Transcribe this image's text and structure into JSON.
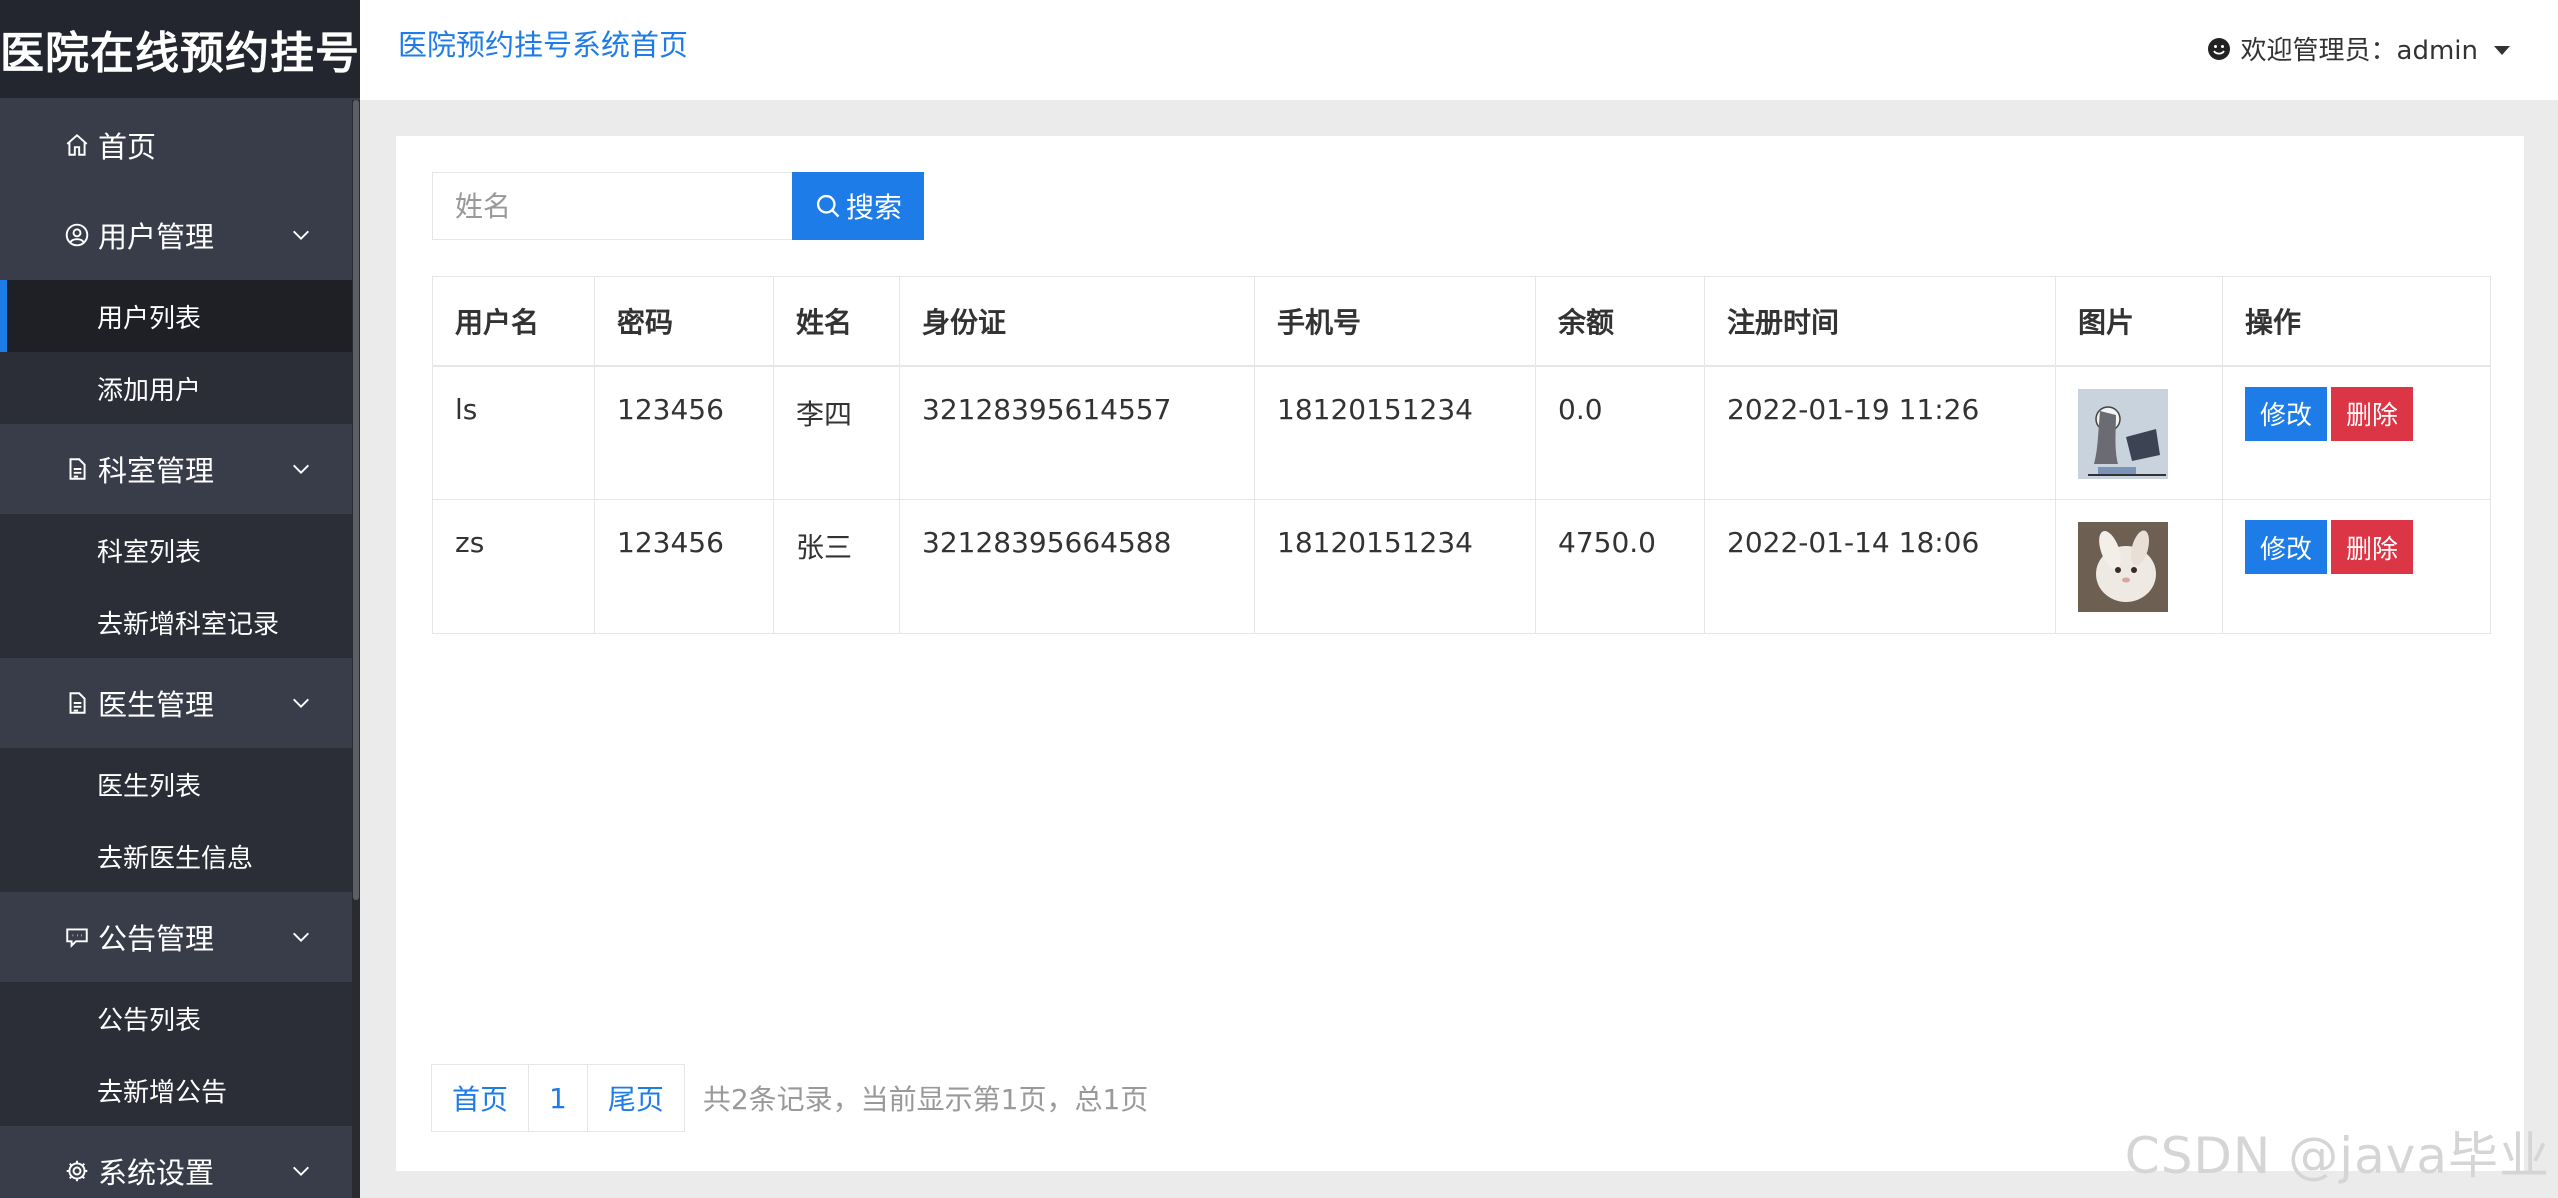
{
  "app": {
    "brand": "医院在线预约挂号"
  },
  "header": {
    "home_link": "医院预约挂号系统首页",
    "welcome": "欢迎管理员：admin"
  },
  "sidebar": {
    "home": "首页",
    "groups": [
      {
        "label": "用户管理",
        "icon": "user-circle-icon",
        "items": [
          "用户列表",
          "添加用户"
        ]
      },
      {
        "label": "科室管理",
        "icon": "document-icon",
        "items": [
          "科室列表",
          "去新增科室记录"
        ]
      },
      {
        "label": "医生管理",
        "icon": "document-icon",
        "items": [
          "医生列表",
          "去新医生信息"
        ]
      },
      {
        "label": "公告管理",
        "icon": "message-icon",
        "items": [
          "公告列表",
          "去新增公告"
        ]
      },
      {
        "label": "系统设置",
        "icon": "gear-icon",
        "items": []
      }
    ],
    "active_item": "用户列表"
  },
  "search": {
    "placeholder": "姓名",
    "value": "",
    "button_label": "搜索"
  },
  "table": {
    "headers": [
      "用户名",
      "密码",
      "姓名",
      "身份证",
      "手机号",
      "余额",
      "注册时间",
      "图片",
      "操作"
    ],
    "rows": [
      {
        "username": "ls",
        "password": "123456",
        "name": "李四",
        "id_card": "32128395614557",
        "phone": "18120151234",
        "balance": "0.0",
        "reg_time": "2022-01-19 11:26",
        "image": "woman-at-computer-drawing"
      },
      {
        "username": "zs",
        "password": "123456",
        "name": "张三",
        "id_card": "32128395664588",
        "phone": "18120151234",
        "balance": "4750.0",
        "reg_time": "2022-01-14 18:06",
        "image": "white-rabbit-photo"
      }
    ],
    "edit_label": "修改",
    "delete_label": "删除"
  },
  "pagination": {
    "first": "首页",
    "current": "1",
    "last": "尾页",
    "info": "共2条记录，当前显示第1页，总1页"
  },
  "watermark": "CSDN @java毕业",
  "colors": {
    "accent": "#1e7ce8",
    "danger": "#dc3545",
    "sidebar_bg": "#393d49",
    "sidebar_sub_bg": "#2b2e36"
  }
}
